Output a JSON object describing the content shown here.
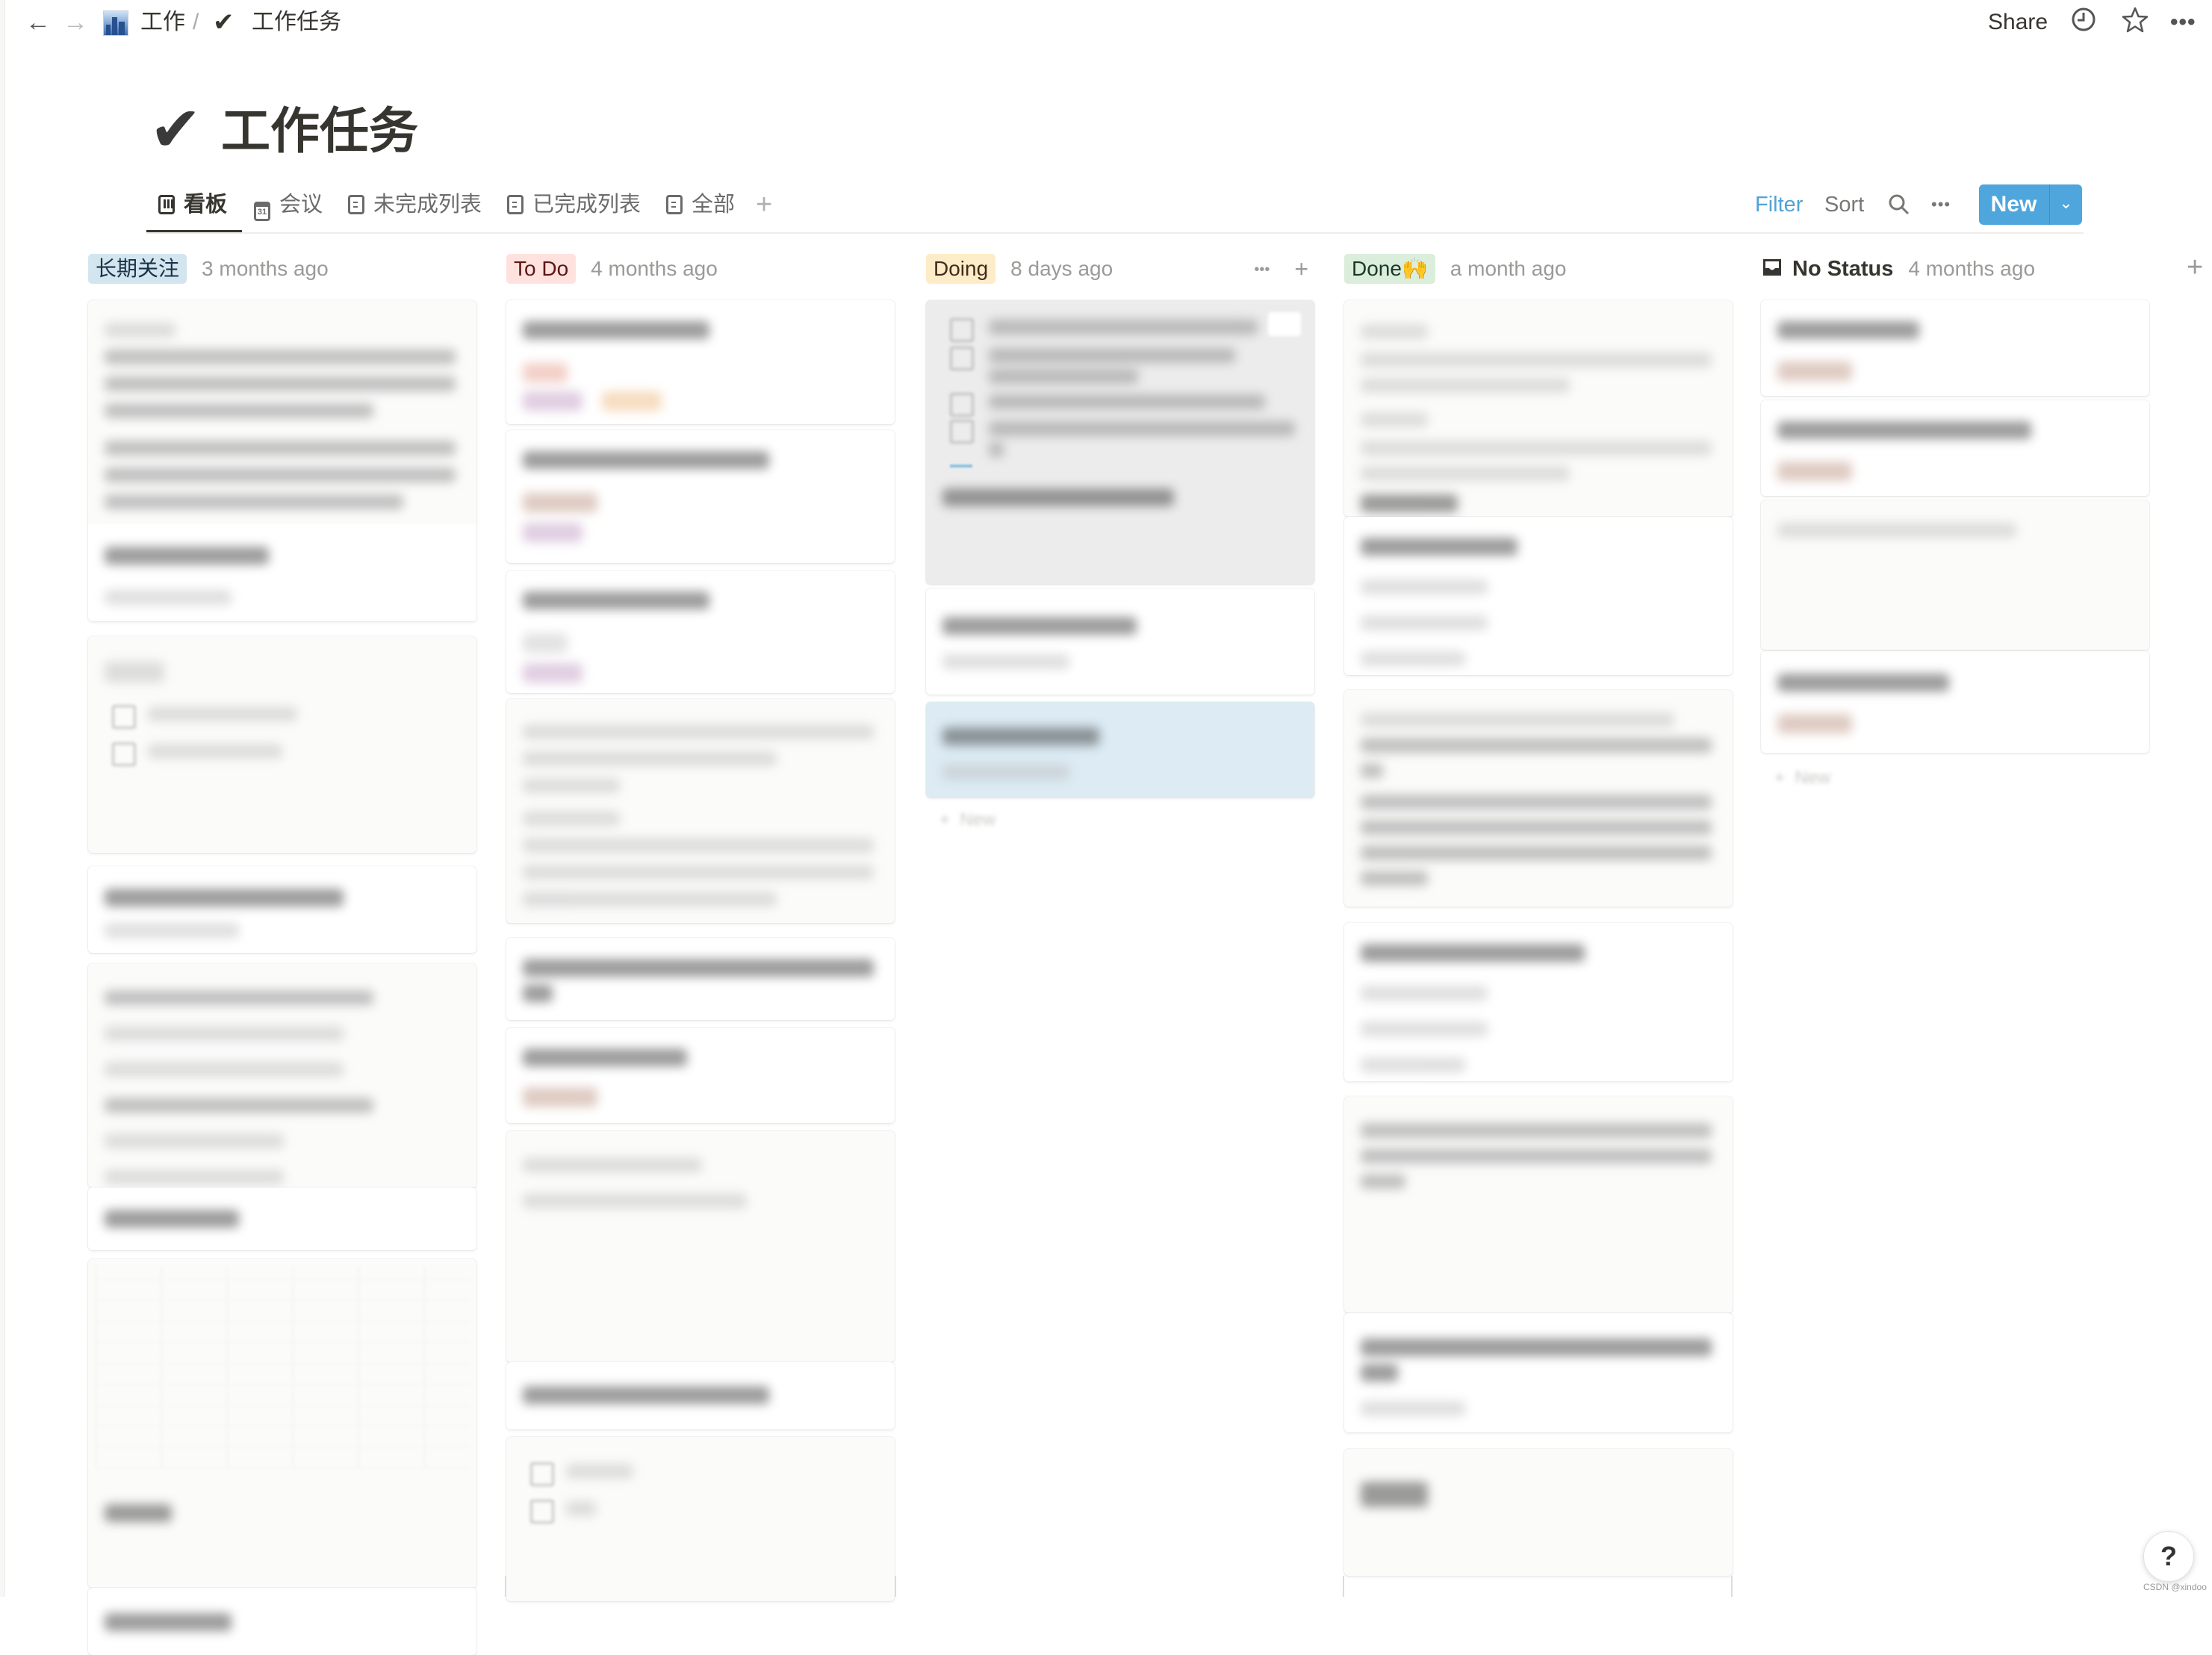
{
  "topbar": {
    "back_icon": "arrow-left-icon",
    "forward_icon": "arrow-right-icon",
    "breadcrumb": [
      {
        "icon": "city-icon",
        "label": "工作"
      },
      {
        "icon": "checkmark-icon",
        "label": "工作任务"
      }
    ],
    "separator": "/",
    "share_label": "Share",
    "history_icon": "clock-icon",
    "favorite_icon": "star-icon",
    "more_icon": "ellipsis-icon"
  },
  "page": {
    "icon": "✔",
    "title": "工作任务"
  },
  "views": {
    "tabs": [
      {
        "label": "看板",
        "icon": "board-icon",
        "active": true
      },
      {
        "label": "会议",
        "icon": "calendar-icon",
        "calendar_day": "31",
        "active": false
      },
      {
        "label": "未完成列表",
        "icon": "list-icon",
        "active": false
      },
      {
        "label": "已完成列表",
        "icon": "list-icon",
        "active": false
      },
      {
        "label": "全部",
        "icon": "list-icon",
        "active": false
      }
    ],
    "add_view": "+"
  },
  "toolbar": {
    "filter_label": "Filter",
    "sort_label": "Sort",
    "search_icon": "search-icon",
    "more_icon": "ellipsis-icon",
    "new_label": "New",
    "new_dropdown_icon": "chevron-down-icon",
    "accent_color": "#4ea6dc",
    "filter_color": "#4fa3d6"
  },
  "board": {
    "columns": [
      {
        "name": "长期关注",
        "updated": "3 months ago",
        "badge_bg": "#d3e5ef",
        "badge_fg": "#183347",
        "cards_blurred": true
      },
      {
        "name": "To Do",
        "updated": "4 months ago",
        "badge_bg": "#ffe2dd",
        "badge_fg": "#5d1715",
        "cards_blurred": true
      },
      {
        "name": "Doing",
        "updated": "8 days ago",
        "badge_bg": "#fdecc8",
        "badge_fg": "#402c1b",
        "cards_blurred": true,
        "actions": {
          "more": "•••",
          "add": "+"
        }
      },
      {
        "name": "Done🙌",
        "updated": "a month ago",
        "badge_bg": "#dbeddb",
        "badge_fg": "#1c3829",
        "cards_blurred": true
      },
      {
        "name": "No Status",
        "updated": "4 months ago",
        "icon": "inbox-icon",
        "cards_blurred": true
      }
    ],
    "add_group": "+"
  },
  "help": {
    "label": "?"
  },
  "watermark": "CSDN @xindoo"
}
